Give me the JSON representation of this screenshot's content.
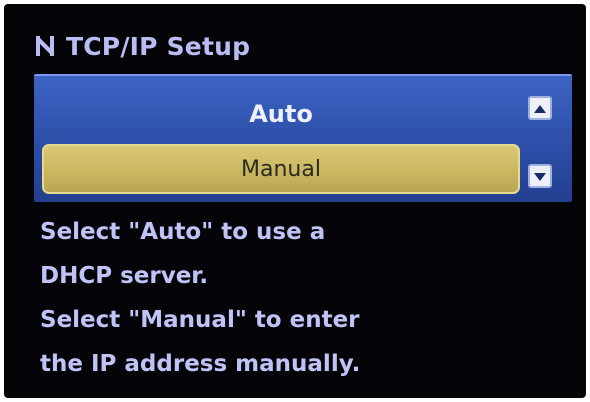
{
  "header": {
    "title": "TCP/IP Setup",
    "icon": "network-icon"
  },
  "menu": {
    "items": [
      {
        "label": "Auto",
        "selected": false
      },
      {
        "label": "Manual",
        "selected": true
      }
    ],
    "scroll_up_icon": "triangle-up-icon",
    "scroll_down_icon": "triangle-down-icon"
  },
  "help": {
    "lines": [
      "Select \"Auto\" to use a",
      "DHCP server.",
      "Select \"Manual\" to enter",
      "the IP address manually."
    ]
  },
  "colors": {
    "screen_bg": "#050509",
    "panel_blue": "#2d4ea8",
    "selection_yellow": "#c9b65e",
    "text_lavender": "#bfc3f6"
  }
}
